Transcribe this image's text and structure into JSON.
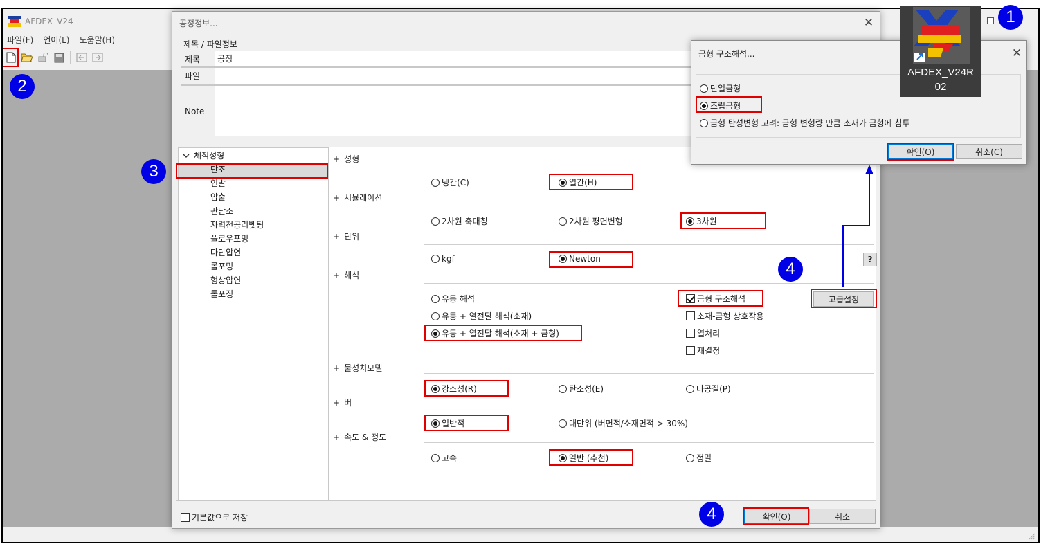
{
  "app": {
    "title": "AFDEX_V24",
    "menu": [
      "파일(F)",
      "언어(L)",
      "도움말(H)"
    ],
    "toolbar_icons": [
      "new-file-icon",
      "open-folder-icon",
      "lock-icon",
      "save-icon",
      "step-back-icon",
      "step-forward-icon"
    ]
  },
  "process_dialog": {
    "title": "공정정보...",
    "group_label": "제목 / 파일정보",
    "fields": {
      "title_label": "제목",
      "title_value": "공정",
      "file_label": "파일",
      "note_label": "Note"
    },
    "tree": {
      "root": "체적성형",
      "items": [
        "단조",
        "인발",
        "압출",
        "판단조",
        "자력천공리벳팅",
        "플로우포밍",
        "다단압연",
        "롤포밍",
        "형상압연",
        "롤포징"
      ],
      "selected_index": 0
    },
    "sections": {
      "forming": {
        "label": "성형",
        "options": [
          "냉간(C)",
          "열간(H)"
        ],
        "selected": "열간(H)"
      },
      "simulation": {
        "label": "시뮬레이션",
        "options": [
          "2차원 축대칭",
          "2차원 평면변형",
          "3차원"
        ],
        "selected": "3차원"
      },
      "unit": {
        "label": "단위",
        "options": [
          "kgf",
          "Newton"
        ],
        "selected": "Newton",
        "help_label": "?"
      },
      "analysis": {
        "label": "해석",
        "options": [
          "유동 해석",
          "유동 + 열전달 해석(소재)",
          "유동 + 열전달 해석(소재 + 금형)"
        ],
        "selected": "유동 + 열전달 해석(소재 + 금형)",
        "checks": [
          {
            "label": "금형 구조해석",
            "checked": true
          },
          {
            "label": "소재-금형 상호작용",
            "checked": false
          },
          {
            "label": "열처리",
            "checked": false
          },
          {
            "label": "재결정",
            "checked": false
          }
        ],
        "advanced_label": "고급설정"
      },
      "material_model": {
        "label": "물성치모델",
        "options": [
          "강소성(R)",
          "탄소성(E)",
          "다공질(P)"
        ],
        "selected": "강소성(R)"
      },
      "burr": {
        "label": "버",
        "options": [
          "일반적",
          "대단위 (버면적/소재면적 > 30%)"
        ],
        "selected": "일반적"
      },
      "speed": {
        "label": "속도 & 정도",
        "options": [
          "고속",
          "일반 (추천)",
          "정밀"
        ],
        "selected": "일반 (추천)"
      }
    },
    "save_default_label": "기본값으로 저장",
    "ok_label": "확인(O)",
    "cancel_label": "취소"
  },
  "mold_dialog": {
    "title": "금형 구조해석...",
    "options": [
      "단일금형",
      "조립금형",
      "금형 탄성변형 고려: 금형 변형량 만큼 소재가 금형에 침투"
    ],
    "selected": "조립금형",
    "ok_label": "확인(O)",
    "cancel_label": "취소(C)"
  },
  "desktop_icon": {
    "label_line1": "AFDEX_V24R",
    "label_line2": "02"
  },
  "callouts": [
    "1",
    "2",
    "3",
    "4",
    "4"
  ],
  "colors": {
    "highlight": "#e00000",
    "callout": "#0000e6",
    "workspace": "#ababab"
  }
}
